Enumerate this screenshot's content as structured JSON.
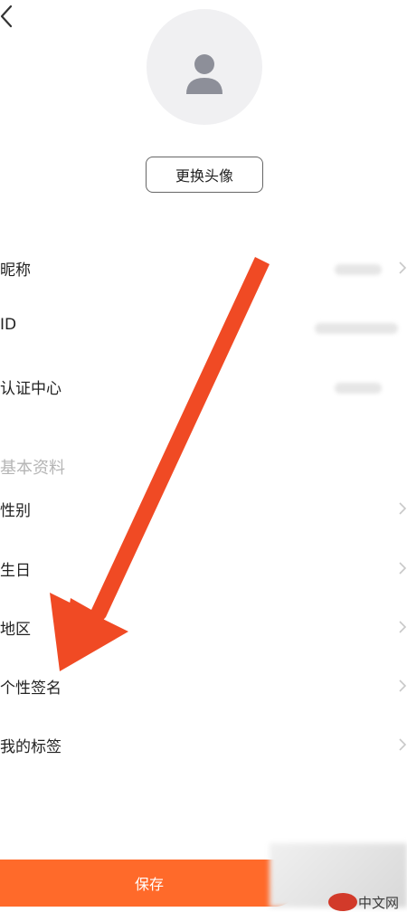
{
  "header": {
    "back_icon": "chevron-left-icon"
  },
  "avatar": {
    "icon": "user-icon",
    "change_label": "更换头像"
  },
  "account_rows": [
    {
      "label": "昵称"
    },
    {
      "label": "ID"
    },
    {
      "label": "认证中心"
    }
  ],
  "basic_info": {
    "title": "基本资料",
    "rows": [
      {
        "label": "性别"
      },
      {
        "label": "生日"
      },
      {
        "label": "地区"
      },
      {
        "label": "个性签名"
      },
      {
        "label": "我的标签"
      }
    ]
  },
  "footer": {
    "save_label": "保存"
  },
  "watermark": {
    "logo_text": "php",
    "text": "中文网"
  },
  "colors": {
    "accent": "#ff6a2a",
    "arrow": "#f04a24",
    "section_title": "#b5b5b5"
  }
}
